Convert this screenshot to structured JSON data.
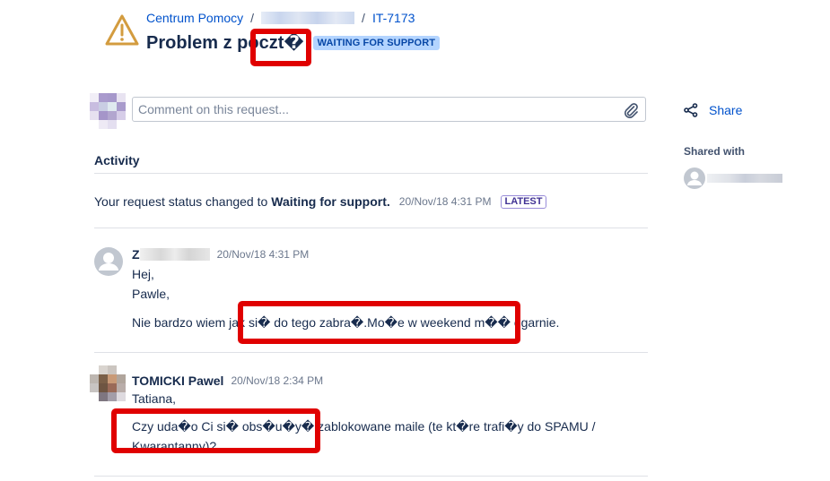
{
  "header": {
    "breadcrumb": {
      "root": "Centrum Pomocy",
      "separator": "/",
      "project_label_redacted": "",
      "issue_key": "IT-7173"
    },
    "title": "Problem z poczt�",
    "status": "WAITING FOR SUPPORT",
    "icon": "warning-triangle-icon",
    "colors": {
      "warning_icon": "#d39c3f",
      "status_bg": "#b3d4ff",
      "status_text": "#0747a6",
      "link": "#0052cc"
    }
  },
  "comment_box": {
    "placeholder": "Comment on this request...",
    "value": "",
    "attach_icon": "paperclip-icon"
  },
  "activity": {
    "heading": "Activity",
    "status_change": {
      "prefix": "Your request status changed to",
      "status": "Waiting for support.",
      "timestamp": "20/Nov/18 4:31 PM",
      "badge": "LATEST"
    },
    "comments": [
      {
        "author": "Z",
        "timestamp": "20/Nov/18 4:31 PM",
        "lines": [
          "Hej,",
          "Pawle,"
        ],
        "paragraph": "Nie bardzo wiem jak si� do tego zabra�.Mo�e w weekend m�� ogarnie."
      },
      {
        "author": "TOMICKI Pawel",
        "timestamp": "20/Nov/18 2:34 PM",
        "lines": [
          "Tatiana,"
        ],
        "paragraph": "Czy uda�o Ci si� obs�u�y� zablokowane maile (te kt�re trafi�y do SPAMU / Kwarantanny)?"
      }
    ]
  },
  "sidebar": {
    "share_label": "Share",
    "share_icon": "share-icon",
    "shared_with_label": "Shared with"
  }
}
